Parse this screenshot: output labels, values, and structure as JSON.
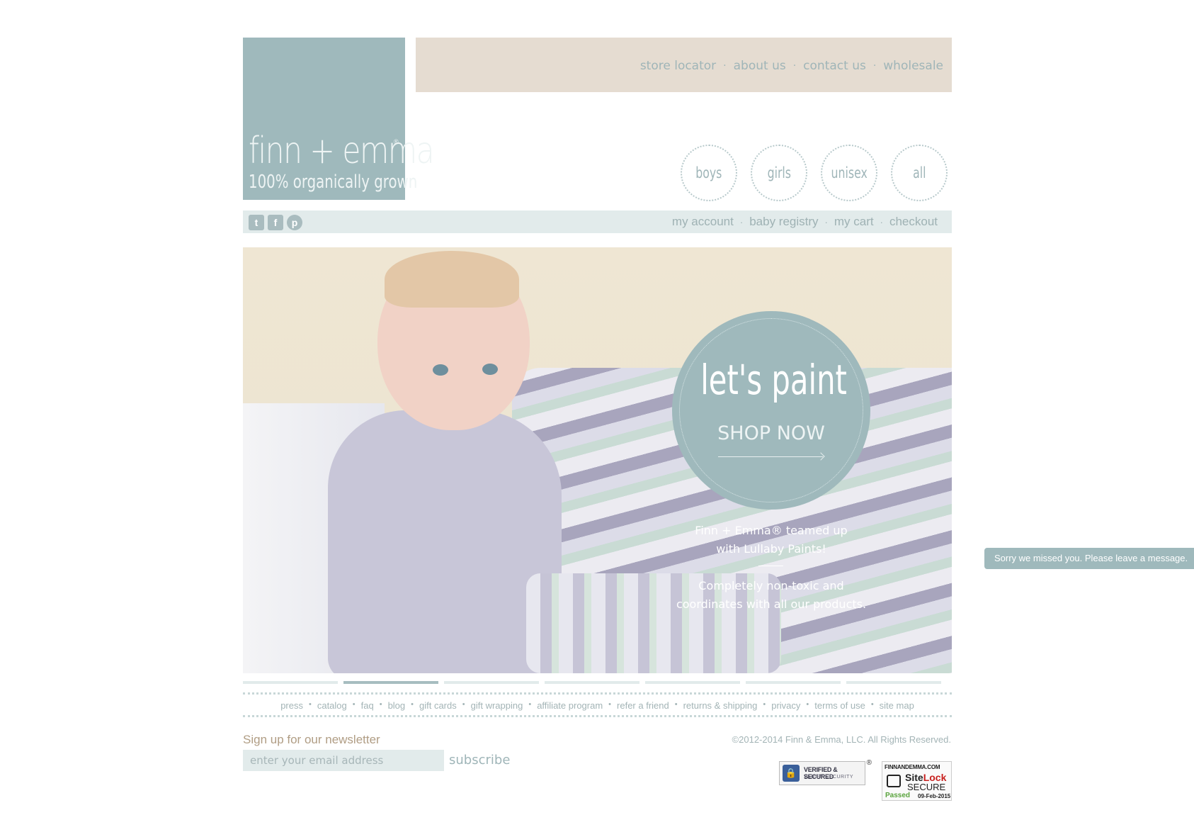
{
  "logo": {
    "brand": "finn + emma",
    "registered": "®",
    "tagline": "100% organically grown"
  },
  "top_nav": {
    "items": [
      "store locator",
      "about us",
      "contact us",
      "wholesale"
    ],
    "separator": "·"
  },
  "categories": [
    "boys",
    "girls",
    "unisex",
    "all"
  ],
  "social": [
    {
      "name": "twitter",
      "glyph": "t"
    },
    {
      "name": "facebook",
      "glyph": "f"
    },
    {
      "name": "pinterest",
      "glyph": "p"
    }
  ],
  "account_nav": {
    "items": [
      "my account",
      "baby registry",
      "my cart",
      "checkout"
    ],
    "separator": "·"
  },
  "hero": {
    "headline": "let's paint",
    "cta": "SHOP NOW",
    "line1": "Finn + Emma® teamed up",
    "line2": "with Lullaby Paints!",
    "line3": "Completely non-toxic and",
    "line4": "coordinates with all our products.",
    "slides_total": 7,
    "slide_active_index": 1
  },
  "footer_links": [
    "press",
    "catalog",
    "faq",
    "blog",
    "gift cards",
    "gift wrapping",
    "affiliate program",
    "refer a friend",
    "returns & shipping",
    "privacy",
    "terms of use",
    "site map"
  ],
  "newsletter": {
    "title": "Sign up for our newsletter",
    "placeholder": "enter your email address",
    "button": "subscribe"
  },
  "copyright": "©2012-2014 Finn & Emma, LLC. All Rights Reserved.",
  "badges": {
    "verified": {
      "line1": "VERIFIED & SECURED",
      "line2": "VERIFY SECURITY",
      "mark": "®"
    },
    "sitelock": {
      "domain": "FINNANDEMMA.COM",
      "brand_a": "Site",
      "brand_b": "Lock",
      "secure": "SECURE",
      "status": "Passed",
      "date": "09-Feb-2015"
    }
  },
  "chat": {
    "label": "Sorry we missed you. Please leave a message."
  },
  "colors": {
    "accent": "#9fb9bc",
    "beige": "#e5dcd1",
    "light": "#e2ebeb",
    "newsletter_title": "#b09d84"
  }
}
